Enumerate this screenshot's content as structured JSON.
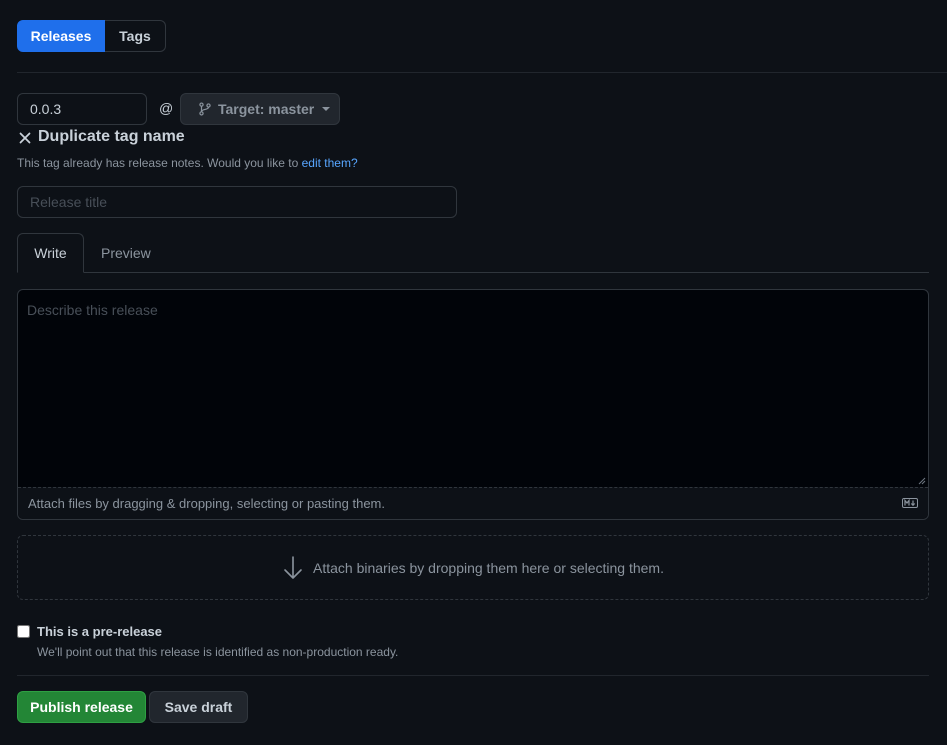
{
  "nav": {
    "releases_label": "Releases",
    "tags_label": "Tags"
  },
  "tag": {
    "value": "0.0.3",
    "at_symbol": "@",
    "target_label": "Target: master"
  },
  "warning": {
    "title": "Duplicate tag name",
    "message": "This tag already has release notes. Would you like to ",
    "link": "edit them?"
  },
  "release_title": {
    "placeholder": "Release title"
  },
  "editor_tabs": {
    "write": "Write",
    "preview": "Preview"
  },
  "description": {
    "placeholder": "Describe this release",
    "attach_text": "Attach files by dragging & dropping, selecting or pasting them."
  },
  "binaries": {
    "text": "Attach binaries by dropping them here or selecting them."
  },
  "prerelease": {
    "label": "This is a pre-release",
    "description": "We'll point out that this release is identified as non-production ready.",
    "checked": false
  },
  "actions": {
    "publish": "Publish release",
    "save_draft": "Save draft"
  },
  "colors": {
    "background": "#0d1117",
    "accent_blue": "#1f6feb",
    "publish_green": "#238636",
    "link_blue": "#58a6ff"
  },
  "icons": {
    "branch": "git-branch-icon",
    "close": "x-icon",
    "markdown": "markdown-icon",
    "arrow": "arrow-down-icon"
  }
}
